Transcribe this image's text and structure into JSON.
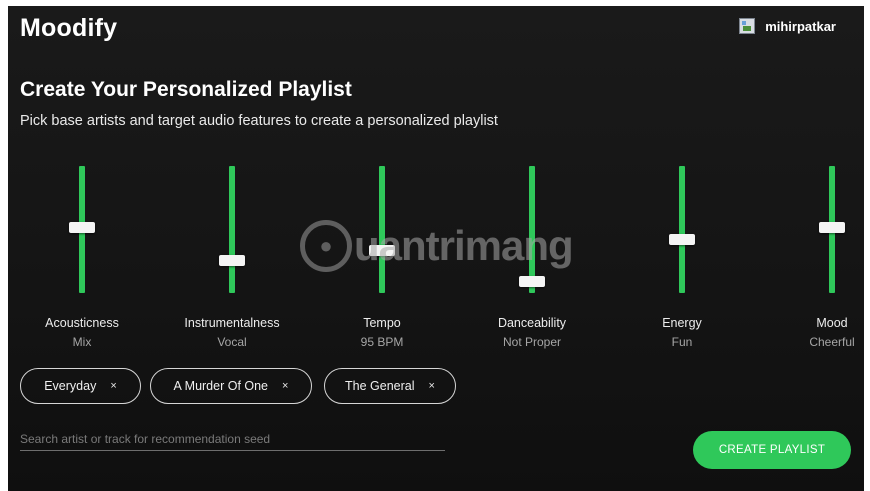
{
  "app": {
    "name": "Moodify",
    "username": "mihirpatkar"
  },
  "page": {
    "title": "Create Your Personalized Playlist",
    "subtitle": "Pick base artists and target audio features to create a personalized playlist"
  },
  "sliders": [
    {
      "name": "Acousticness",
      "value_label": "Mix",
      "level": 0.52
    },
    {
      "name": "Instrumentalness",
      "value_label": "Vocal",
      "level": 0.23
    },
    {
      "name": "Tempo",
      "value_label": "95 BPM",
      "level": 0.32
    },
    {
      "name": "Danceability",
      "value_label": "Not Proper",
      "level": 0.05
    },
    {
      "name": "Energy",
      "value_label": "Fun",
      "level": 0.41
    },
    {
      "name": "Mood",
      "value_label": "Cheerful",
      "level": 0.52
    }
  ],
  "seeds": [
    {
      "label": "Everyday",
      "remove": "×"
    },
    {
      "label": "A Murder Of One",
      "remove": "×"
    },
    {
      "label": "The General",
      "remove": "×"
    }
  ],
  "search": {
    "placeholder": "Search artist or track for recommendation seed",
    "value": ""
  },
  "actions": {
    "create_label": "CREATE PLAYLIST"
  },
  "watermark": {
    "text": "uantrimang",
    "icon": "lightbulb-icon"
  },
  "colors": {
    "accent": "#2fc85a",
    "background": "#151515",
    "thumb": "#f4f4f4"
  }
}
